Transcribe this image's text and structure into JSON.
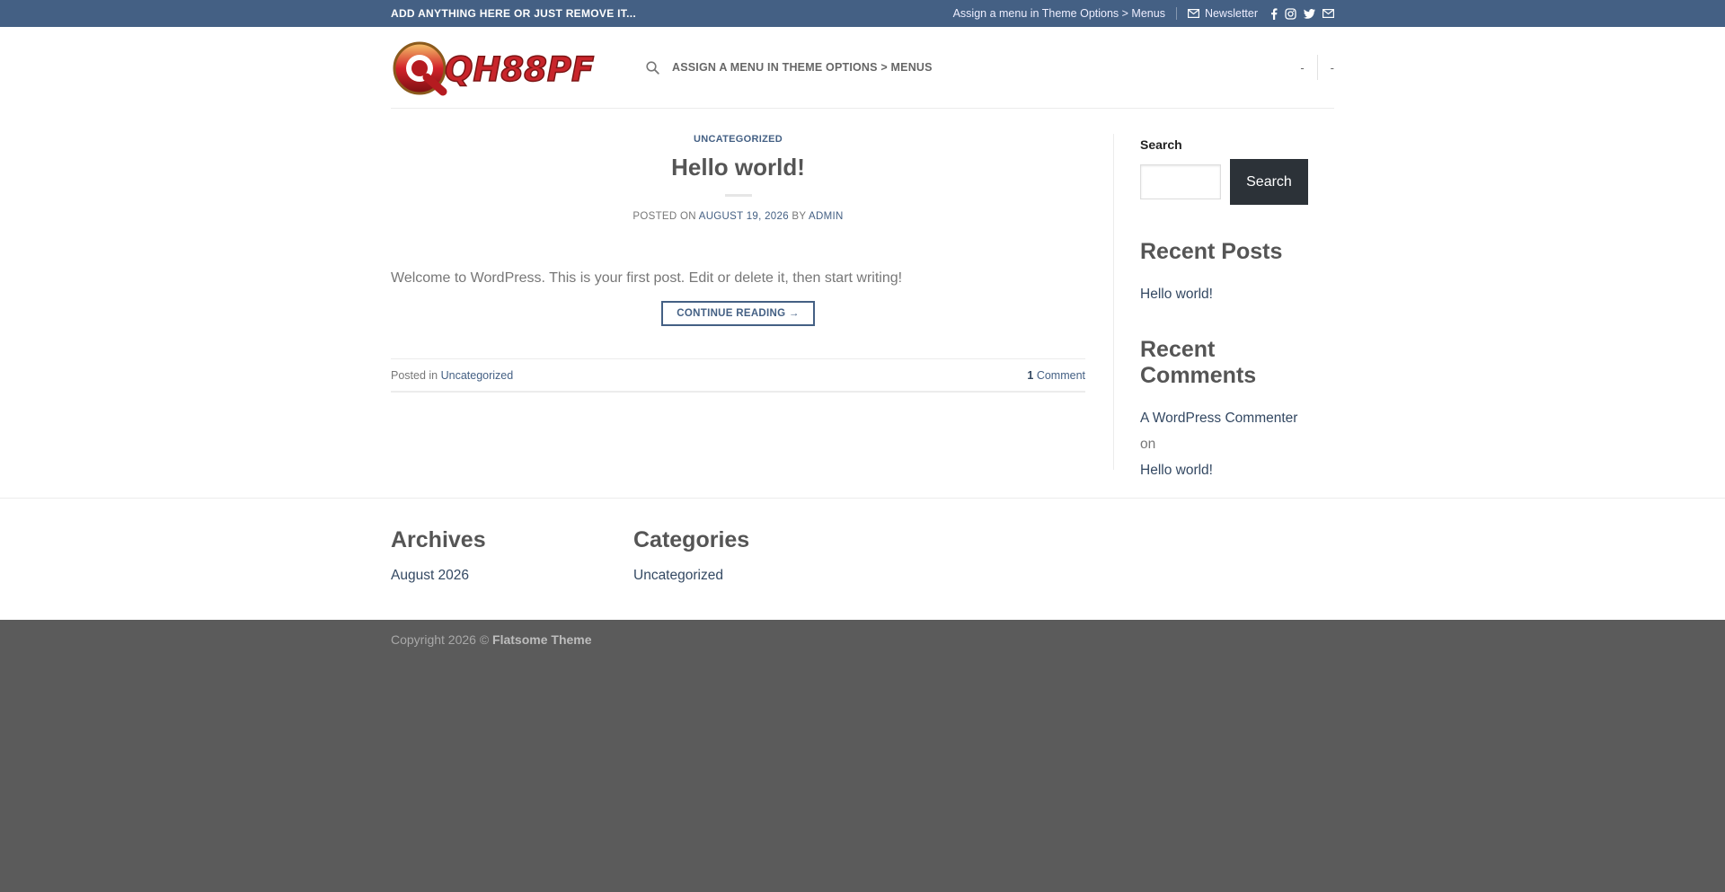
{
  "topbar": {
    "promo": "ADD ANYTHING HERE OR JUST REMOVE IT...",
    "menu_hint": "Assign a menu in Theme Options > Menus",
    "newsletter": "Newsletter",
    "social_icons": [
      "facebook-icon",
      "instagram-icon",
      "twitter-icon",
      "email-icon"
    ]
  },
  "header": {
    "logo_text": "QH88PF",
    "nav_hint": "ASSIGN A MENU IN THEME OPTIONS > MENUS",
    "right_item_1": "-",
    "right_item_2": "-"
  },
  "post": {
    "category": "UNCATEGORIZED",
    "title": "Hello world!",
    "posted_on": "POSTED ON",
    "date": "AUGUST 19, 2026",
    "by": "BY",
    "author": "ADMIN",
    "excerpt": "Welcome to WordPress. This is your first post. Edit or delete it, then start writing!",
    "continue": "CONTINUE READING →",
    "posted_in": "Posted in",
    "posted_in_category": "Uncategorized",
    "comment_count": "1",
    "comment_label": "Comment"
  },
  "sidebar": {
    "search_label": "Search",
    "search_button": "Search",
    "recent_posts_heading": "Recent Posts",
    "recent_post_1": "Hello world!",
    "recent_comments_heading": "Recent Comments",
    "commenter": "A WordPress Commenter",
    "on": "on",
    "comment_post": "Hello world!"
  },
  "footer_widgets": {
    "archives_heading": "Archives",
    "archive_1": "August 2026",
    "categories_heading": "Categories",
    "category_1": "Uncategorized"
  },
  "footer": {
    "copyright": "Copyright 2026 ©",
    "theme": "Flatsome Theme"
  },
  "colors": {
    "primary": "#446084",
    "secondary": "#334862",
    "footer_bg": "#5b5b5b"
  }
}
